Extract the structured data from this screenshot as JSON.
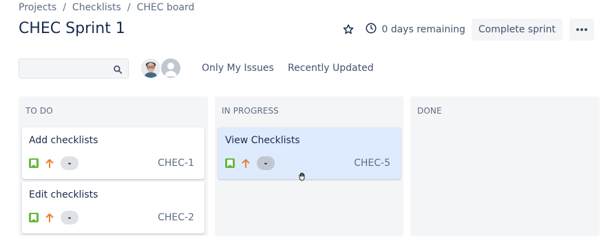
{
  "breadcrumb": [
    "Projects",
    "Checklists",
    "CHEC board"
  ],
  "breadcrumb_sep": "/",
  "title": "CHEC Sprint 1",
  "header": {
    "days_remaining": "0 days remaining",
    "complete_label": "Complete sprint",
    "more_label": "•••"
  },
  "search": {
    "value": "",
    "placeholder": ""
  },
  "quick_filters": [
    "Only My Issues",
    "Recently Updated"
  ],
  "columns": [
    {
      "name": "TO DO",
      "cards": [
        {
          "title": "Add checklists",
          "estimate": "-",
          "key": "CHEC-1"
        },
        {
          "title": "Edit checklists",
          "estimate": "-",
          "key": "CHEC-2"
        }
      ]
    },
    {
      "name": "IN PROGRESS",
      "cards": [
        {
          "title": "View Checklists",
          "estimate": "-",
          "key": "CHEC-5"
        }
      ]
    },
    {
      "name": "DONE",
      "cards": []
    }
  ],
  "colors": {
    "story": "#63ba3c",
    "priority_high": "#e97f33",
    "selected_card": "#deebff",
    "column_bg": "#f4f5f7"
  },
  "icons": {
    "star": "star-icon",
    "clock": "clock-icon",
    "search": "search-icon",
    "story": "story-icon",
    "priority": "priority-high-icon"
  }
}
